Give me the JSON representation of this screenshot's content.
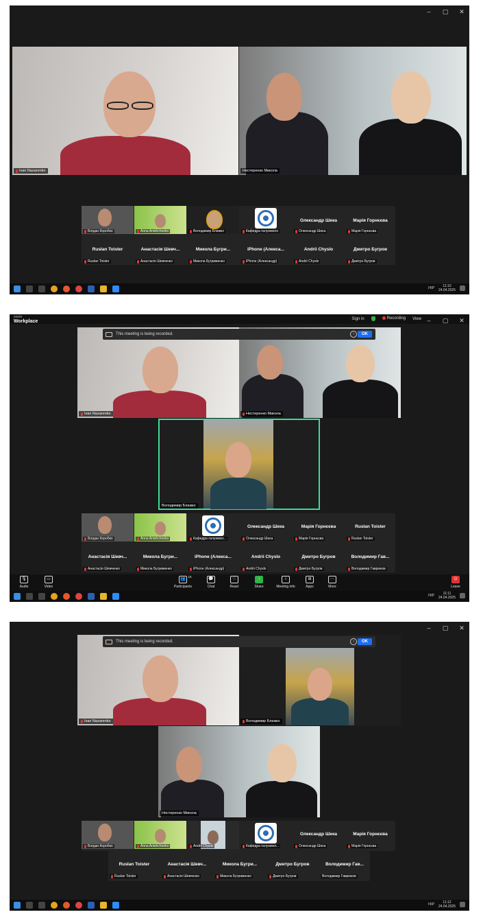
{
  "window_controls": {
    "minimize": "–",
    "maximize": "▢",
    "close": "✕"
  },
  "s1": {
    "main_tiles": [
      {
        "name": "Ivan Nazarenko"
      },
      {
        "name": "Нестеренко Микола"
      }
    ],
    "gallery": [
      {
        "label": "Богдан Коробко"
      },
      {
        "label": "Anna Anishchenko"
      },
      {
        "label": "Володимир Блажко"
      },
      {
        "label": "Кафедра галузевого"
      },
      {
        "title": "Олександр Шека",
        "label": "Олександр Шека"
      },
      {
        "title": "Марія Горнєєва",
        "label": "Марія Горнєєва"
      },
      {
        "title": "Ruslan Toister",
        "label": "Ruslan Toister"
      },
      {
        "title": "Анастасія Шевч...",
        "label": "Анастасія Шевченко"
      },
      {
        "title": "Микола Бугри...",
        "label": "Микола Бугрименко"
      },
      {
        "title": "iPhone (Алекса...",
        "label": "iPhone (Александр)"
      },
      {
        "title": "Andrii Chyslo",
        "label": "Andrii Chyslo"
      },
      {
        "title": "Дмитро Бугров",
        "label": "Дмитро Бугров"
      }
    ],
    "clock": {
      "time": "11:10",
      "date": "24.04.2025",
      "lang": "УКР"
    }
  },
  "s2": {
    "app": {
      "brand_small": "zoom",
      "brand": "Workplace"
    },
    "titlebar": {
      "sign_in": "Sign in",
      "recording": "Recording",
      "view": "View"
    },
    "recording_banner": {
      "text": "This meeting is being recorded.",
      "ok": "OK"
    },
    "main_tiles": [
      {
        "name": "Ivan Nazarenko"
      },
      {
        "name": "Нестеренко Микола"
      },
      {
        "name": "Володимир Блажко"
      }
    ],
    "gallery": [
      {
        "label": "Богдан Коробко"
      },
      {
        "label": "Anna Anishchenko"
      },
      {
        "label": "Кафедра галузевог..."
      },
      {
        "title": "Олександр Шека",
        "label": "Олександр Шека"
      },
      {
        "title": "Марія Горнєєва",
        "label": "Марія Горнєєва"
      },
      {
        "title": "Ruslan Toister",
        "label": "Ruslan Toister"
      },
      {
        "title": "Анастасія Шевч...",
        "label": "Анастасія Шевченко"
      },
      {
        "title": "Микола Бугри...",
        "label": "Микола Бугрименко"
      },
      {
        "title": "iPhone (Алекса...",
        "label": "iPhone (Александр)"
      },
      {
        "title": "Andrii Chyslo",
        "label": "Andrii Chyslo"
      },
      {
        "title": "Дмитро Бугров",
        "label": "Дмитро Бугров"
      },
      {
        "title": "Володимир Гав...",
        "label": "Володимир Гаврюков"
      }
    ],
    "toolbar": {
      "audio": "Audio",
      "video": "Video",
      "participants": "Participants",
      "participants_count": "15",
      "chat": "Chat",
      "react": "React",
      "share": "Share",
      "meeting_info": "Meeting info",
      "apps": "Apps",
      "more": "More",
      "leave": "Leave"
    },
    "clock": {
      "time": "11:11",
      "date": "24.04.2025",
      "lang": "УКР"
    }
  },
  "s3": {
    "recording_banner": {
      "text": "This meeting is being recorded.",
      "ok": "OK"
    },
    "main_tiles": [
      {
        "name": "Ivan Nazarenko"
      },
      {
        "name": "Володимир Блажко"
      },
      {
        "name": "Нестеренко Микола"
      }
    ],
    "gallery": [
      {
        "label": "Богдан Коробко"
      },
      {
        "label": "Anna Anishchenko"
      },
      {
        "label": "Andrii Chyslo"
      },
      {
        "label": "Кафедра галузевог..."
      },
      {
        "title": "Олександр Шека",
        "label": "Олександр Шека"
      },
      {
        "title": "Марія Горнєєва",
        "label": "Марія Горнєєва"
      },
      {
        "title": "Ruslan Toister",
        "label": "Ruslan Toister"
      },
      {
        "title": "Анастасія Шевч...",
        "label": "Анастасія Шевченко"
      },
      {
        "title": "Микола Бугри...",
        "label": "Микола Бугрименко"
      },
      {
        "title": "Дмитро Бугров",
        "label": "Дмитро Бугров"
      },
      {
        "title": "Володимир Гав...",
        "label": "Володимир Гаврюков"
      }
    ],
    "clock": {
      "time": "11:12",
      "date": "24.04.2025",
      "lang": "УКР"
    }
  },
  "colors": {
    "active_speaker": "#3ddc97",
    "ok_button": "#1e6ef0",
    "muted_mic": "#e03a3a",
    "share": "#2fb344"
  }
}
